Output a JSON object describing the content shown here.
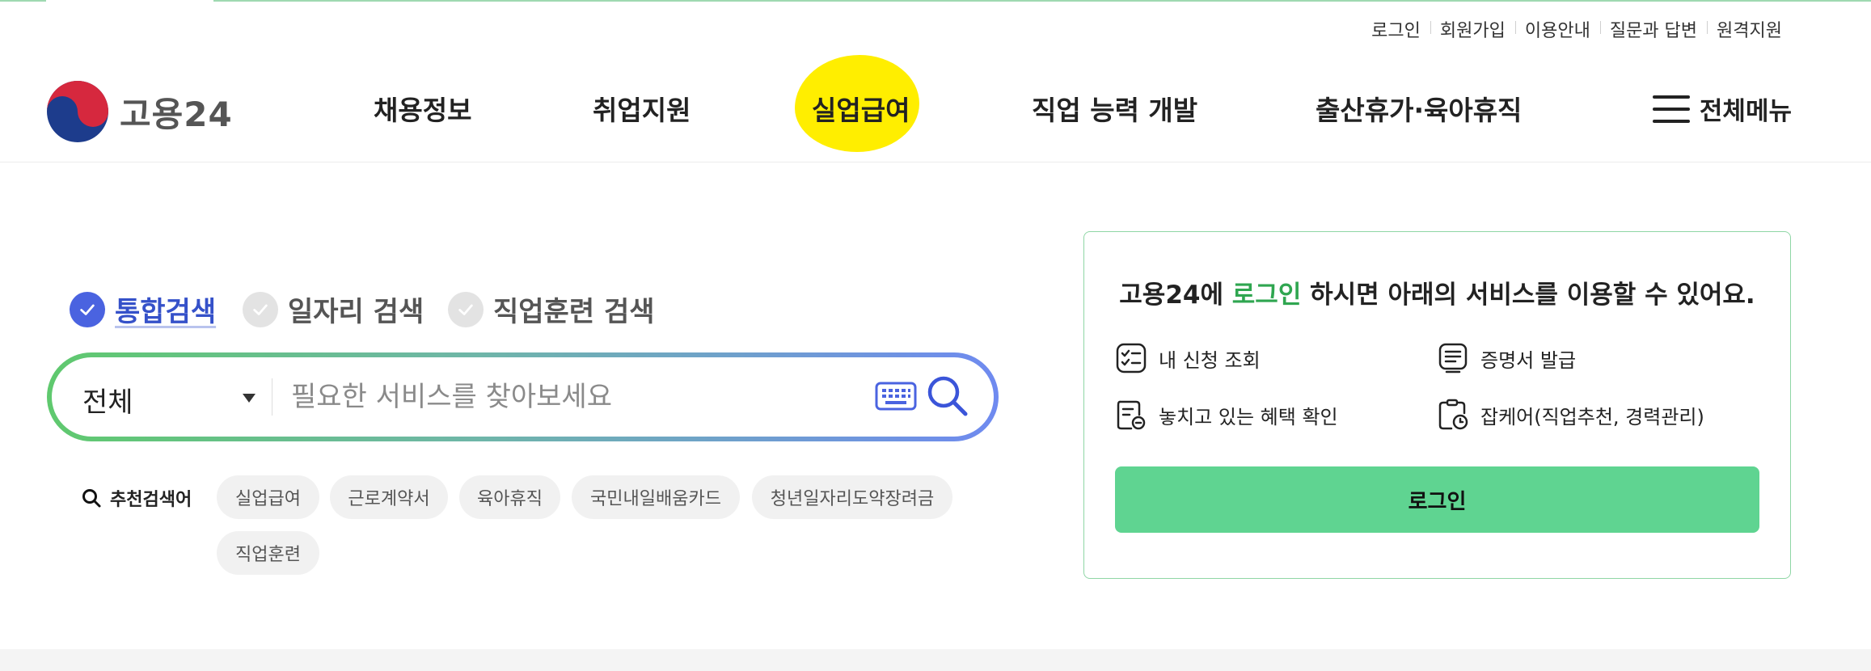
{
  "utility_links": [
    "로그인",
    "회원가입",
    "이용안내",
    "질문과 답변",
    "원격지원"
  ],
  "logo": {
    "text": "고용24"
  },
  "nav": {
    "items": [
      "채용정보",
      "취업지원",
      "실업급여",
      "직업 능력 개발",
      "출산휴가·육아휴직"
    ],
    "all_menu": "전체메뉴",
    "highlighted_item": "실업급여",
    "highlight_color": "#ffee00"
  },
  "search": {
    "types": [
      "통합검색",
      "일자리 검색",
      "직업훈련 검색"
    ],
    "selected_type": "통합검색",
    "category": "전체",
    "placeholder": "필요한 서비스를 찾아보세요",
    "value": ""
  },
  "recommended": {
    "title": "추천검색어",
    "keywords": [
      "실업급여",
      "근로계약서",
      "육아휴직",
      "국민내일배움카드",
      "청년일자리도약장려금",
      "직업훈련"
    ]
  },
  "login_panel": {
    "message_prefix": "고용24에 ",
    "message_highlight": "로그인",
    "message_suffix": " 하시면 아래의 서비스를 이용할 수 있어요.",
    "services": [
      "내 신청 조회",
      "증명서 발급",
      "놓치고 있는 혜택 확인",
      "잡케어(직업추천, 경력관리)"
    ],
    "button": "로그인"
  },
  "colors": {
    "accent_green": "#5fd491",
    "accent_blue": "#4a63e0",
    "brand_red": "#d6283e",
    "brand_navy": "#1d3c8c"
  }
}
